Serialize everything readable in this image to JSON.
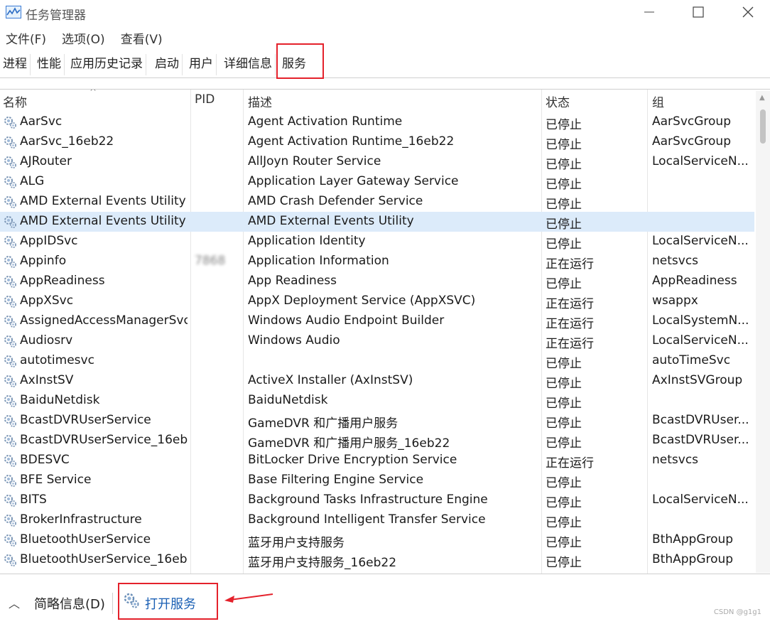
{
  "window": {
    "title": "任务管理器",
    "controls": {
      "minimize": "minimize-icon",
      "maximize": "maximize-icon",
      "close": "close-icon"
    }
  },
  "menu": [
    {
      "label": "文件(F)"
    },
    {
      "label": "选项(O)"
    },
    {
      "label": "查看(V)"
    }
  ],
  "tabs": [
    {
      "label": "进程"
    },
    {
      "label": "性能"
    },
    {
      "label": "应用历史记录"
    },
    {
      "label": "启动"
    },
    {
      "label": "用户"
    },
    {
      "label": "详细信息"
    },
    {
      "label": "服务",
      "active": true
    }
  ],
  "table": {
    "columns": {
      "name": "名称",
      "pid": "PID",
      "desc": "描述",
      "status": "状态",
      "group": "组"
    },
    "sort_indicator": "^",
    "rows": [
      {
        "name": "AarSvc",
        "pid": "",
        "desc": "Agent Activation Runtime",
        "status": "已停止",
        "group": "AarSvcGroup"
      },
      {
        "name": "AarSvc_16eb22",
        "pid": "",
        "desc": "Agent Activation Runtime_16eb22",
        "status": "已停止",
        "group": "AarSvcGroup"
      },
      {
        "name": "AJRouter",
        "pid": "",
        "desc": "AllJoyn Router Service",
        "status": "已停止",
        "group": "LocalServiceN..."
      },
      {
        "name": "ALG",
        "pid": "",
        "desc": "Application Layer Gateway Service",
        "status": "已停止",
        "group": ""
      },
      {
        "name": "AMD External Events Utility",
        "pid": "",
        "desc": "AMD Crash Defender Service",
        "status": "已停止",
        "group": ""
      },
      {
        "name": "AMD External Events Utility",
        "pid": "",
        "desc": "AMD External Events Utility",
        "status": "已停止",
        "group": "",
        "selected": true
      },
      {
        "name": "AppIDSvc",
        "pid": "",
        "desc": "Application Identity",
        "status": "已停止",
        "group": "LocalServiceN..."
      },
      {
        "name": "Appinfo",
        "pid": "7868",
        "desc": "Application Information",
        "status": "正在运行",
        "group": "netsvcs"
      },
      {
        "name": "AppReadiness",
        "pid": "",
        "desc": "App Readiness",
        "status": "已停止",
        "group": "AppReadiness"
      },
      {
        "name": "AppXSvc",
        "pid": "",
        "desc": "AppX Deployment Service (AppXSVC)",
        "status": "正在运行",
        "group": "wsappx"
      },
      {
        "name": "AssignedAccessManagerSvc",
        "pid": "",
        "desc": "Windows Audio Endpoint Builder",
        "status": "正在运行",
        "group": "LocalSystemN..."
      },
      {
        "name": "Audiosrv",
        "pid": "",
        "desc": "Windows Audio",
        "status": "正在运行",
        "group": "LocalServiceN..."
      },
      {
        "name": "autotimesvc",
        "pid": "",
        "desc": "",
        "status": "已停止",
        "group": "autoTimeSvc"
      },
      {
        "name": "AxInstSV",
        "pid": "",
        "desc": "ActiveX Installer (AxInstSV)",
        "status": "已停止",
        "group": "AxInstSVGroup"
      },
      {
        "name": "BaiduNetdisk",
        "pid": "",
        "desc": "BaiduNetdisk",
        "status": "已停止",
        "group": ""
      },
      {
        "name": "BcastDVRUserService",
        "pid": "",
        "desc": "GameDVR 和广播用户服务",
        "status": "已停止",
        "group": "BcastDVRUser..."
      },
      {
        "name": "BcastDVRUserService_16eb22",
        "pid": "",
        "desc": "GameDVR 和广播用户服务_16eb22",
        "status": "已停止",
        "group": "BcastDVRUser..."
      },
      {
        "name": "BDESVC",
        "pid": "",
        "desc": "BitLocker Drive Encryption Service",
        "status": "正在运行",
        "group": "netsvcs"
      },
      {
        "name": "BFE Service",
        "pid": "",
        "desc": "Base Filtering Engine Service",
        "status": "已停止",
        "group": ""
      },
      {
        "name": "BITS",
        "pid": "",
        "desc": "Background Tasks Infrastructure Engine",
        "status": "已停止",
        "group": "LocalServiceN..."
      },
      {
        "name": "BrokerInfrastructure",
        "pid": "",
        "desc": "Background Intelligent Transfer Service",
        "status": "已停止",
        "group": ""
      },
      {
        "name": "BluetoothUserService",
        "pid": "",
        "desc": "蓝牙用户支持服务",
        "status": "已停止",
        "group": "BthAppGroup"
      },
      {
        "name": "BluetoothUserService_16eb22",
        "pid": "",
        "desc": "蓝牙用户支持服务_16eb22",
        "status": "已停止",
        "group": "BthAppGroup"
      }
    ]
  },
  "footer": {
    "brief_label": "简略信息(D)",
    "open_services_label": "打开服务",
    "watermark": "CSDN @g1g1"
  },
  "colors": {
    "highlight_frame": "#e4212b",
    "selected_row": "#dcebfa",
    "link": "#1a5fb4"
  }
}
